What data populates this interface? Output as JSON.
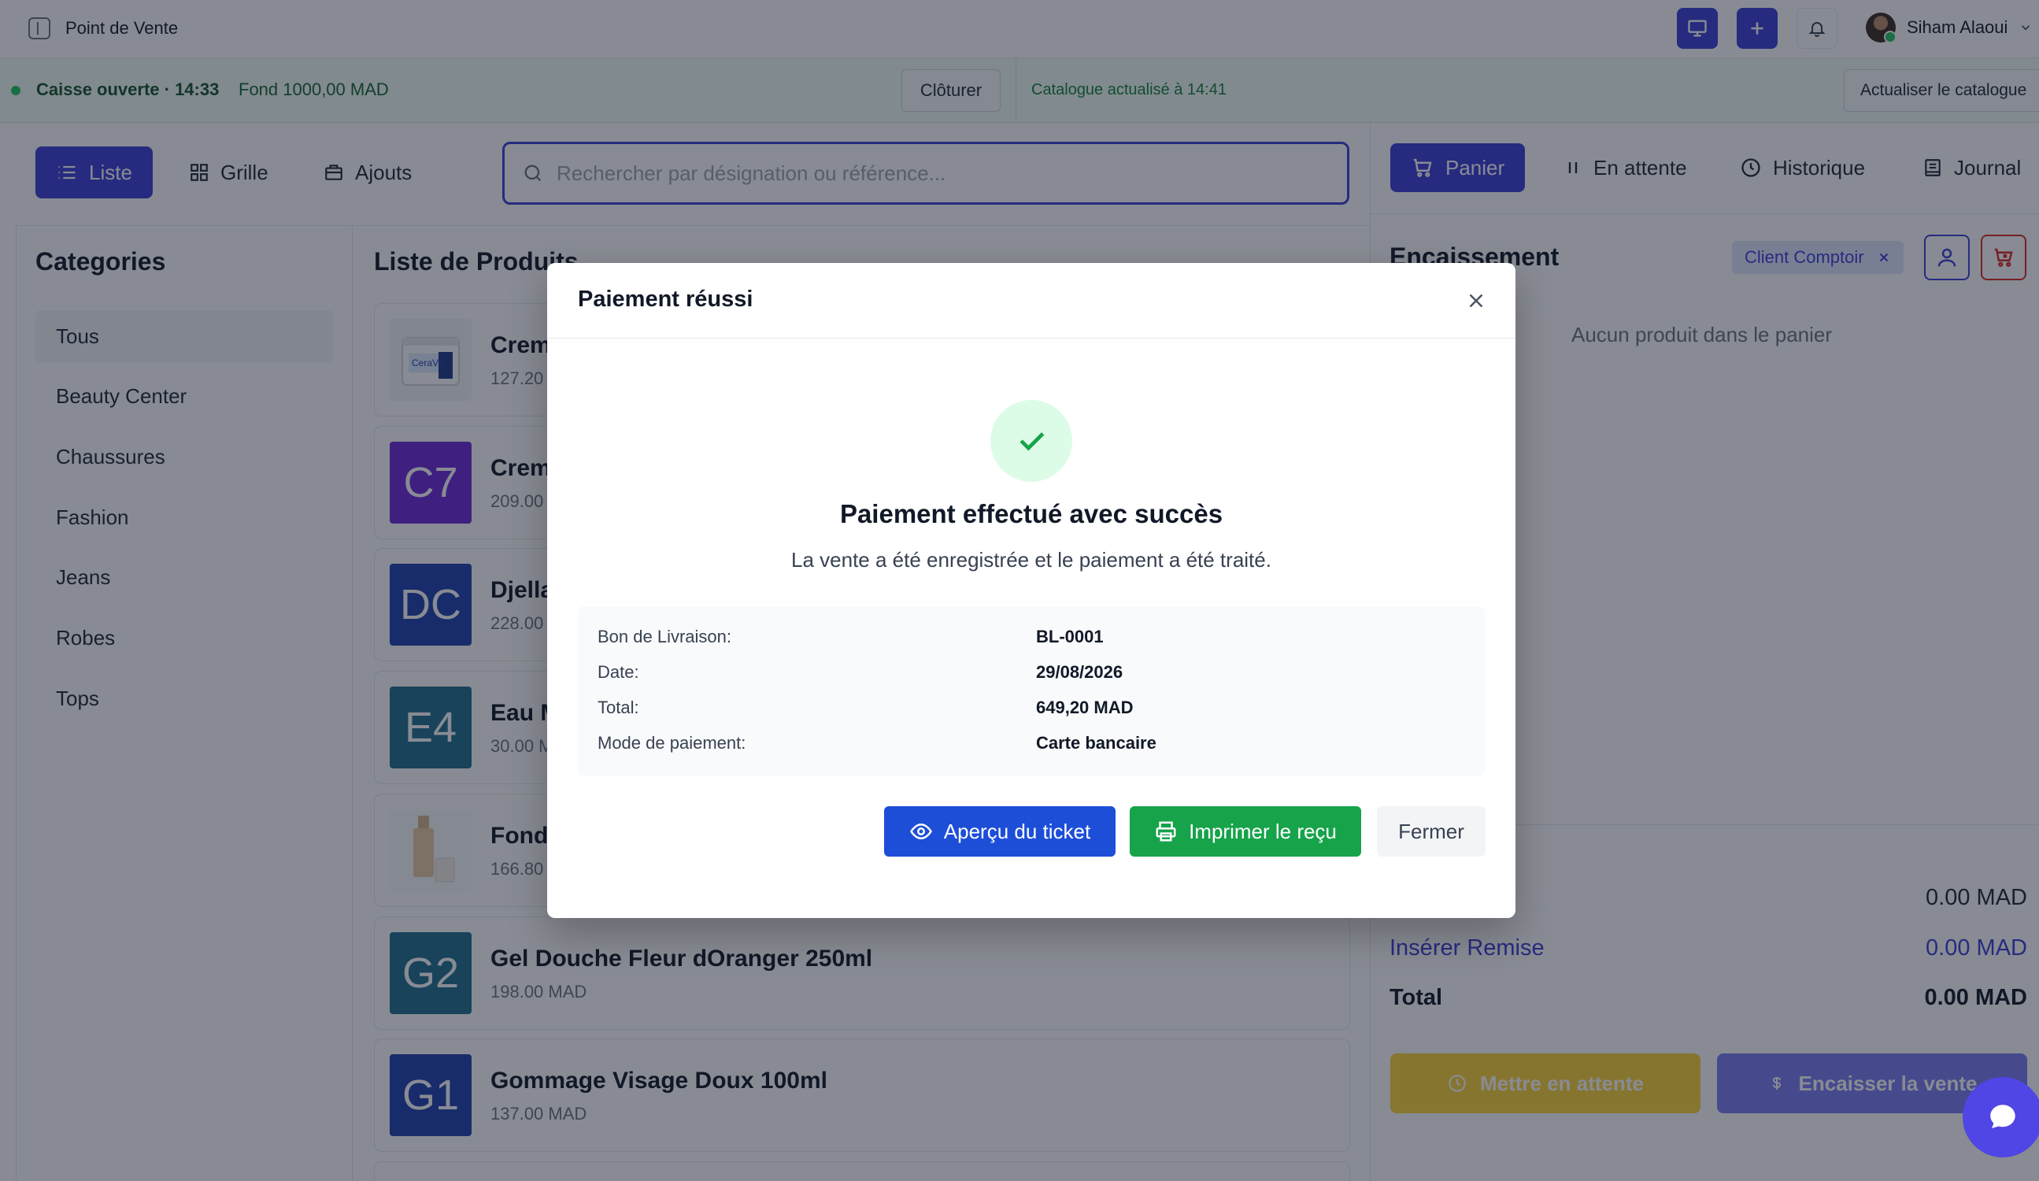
{
  "header": {
    "app_title": "Point de Vente",
    "user_name": "Siham Alaoui"
  },
  "status": {
    "register_open": "Caisse ouverte · 14:33",
    "fund": "Fond 1000,00 MAD",
    "close_register_label": "Clôturer",
    "catalog_updated": "Catalogue actualisé à 14:41",
    "refresh_catalog_label": "Actualiser le catalogue"
  },
  "view_tabs": [
    {
      "label": "Liste",
      "icon": "list-icon"
    },
    {
      "label": "Grille",
      "icon": "grid-icon"
    },
    {
      "label": "Ajouts",
      "icon": "briefcase-icon"
    }
  ],
  "search": {
    "placeholder": "Rechercher par désignation ou référence...",
    "value": ""
  },
  "categories": {
    "title": "Categories",
    "items": [
      "Tous",
      "Beauty Center",
      "Chaussures",
      "Fashion",
      "Jeans",
      "Robes",
      "Tops"
    ]
  },
  "products": {
    "title": "Liste de Produits",
    "items": [
      {
        "name": "Crem",
        "price": "127.20",
        "thumb": "",
        "color": "#ffffff"
      },
      {
        "name": "Crem",
        "price": "209.00",
        "thumb": "C7",
        "color": "#6d28d9"
      },
      {
        "name": "Djella",
        "price": "228.00",
        "thumb": "DC",
        "color": "#1e40af"
      },
      {
        "name": "Eau M",
        "price": "30.00 M",
        "thumb": "E4",
        "color": "#1e6f8f"
      },
      {
        "name": "Fond",
        "price": "166.80",
        "thumb": "",
        "color": "#ffffff"
      },
      {
        "name": "Gel Douche Fleur dOranger 250ml",
        "price": "198.00 MAD",
        "thumb": "G2",
        "color": "#1e6f8f"
      },
      {
        "name": "Gommage Visage Doux 100ml",
        "price": "137.00 MAD",
        "thumb": "G1",
        "color": "#1e40af"
      }
    ]
  },
  "right_tabs": [
    {
      "label": "Panier",
      "icon": "cart-icon"
    },
    {
      "label": "En attente",
      "icon": "pause-icon"
    },
    {
      "label": "Historique",
      "icon": "clock-icon"
    },
    {
      "label": "Journal",
      "icon": "journal-icon"
    }
  ],
  "checkout": {
    "title": "Encaissement",
    "client_chip": "Client Comptoir",
    "empty_cart": "Aucun produit dans le panier",
    "subtotal_value": "0.00 MAD",
    "discount_label": "Insérer Remise",
    "discount_value": "0.00 MAD",
    "total_label": "Total",
    "total_value": "0.00 MAD",
    "hold_label": "Mettre en attente",
    "checkout_label": "Encaisser la vente"
  },
  "modal": {
    "title": "Paiement réussi",
    "success_title": "Paiement effectué avec succès",
    "success_sub": "La vente a été enregistrée et le paiement a été traité.",
    "details": [
      {
        "label": "Bon de Livraison:",
        "value": "BL-0001"
      },
      {
        "label": "Date:",
        "value": "29/08/2026"
      },
      {
        "label": "Total:",
        "value": "649,20 MAD"
      },
      {
        "label": "Mode de paiement:",
        "value": "Carte bancaire"
      }
    ],
    "preview_label": "Aperçu du ticket",
    "print_label": "Imprimer le reçu",
    "close_label": "Fermer"
  },
  "colors": {
    "primary": "#3b3fd6",
    "success": "#16a34a",
    "blue": "#1d4ed8"
  }
}
